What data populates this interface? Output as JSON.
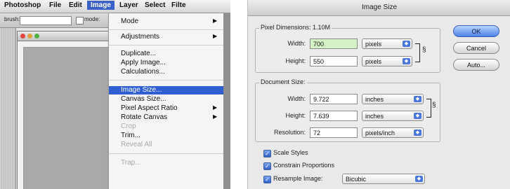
{
  "left": {
    "menubar": [
      "Photoshop",
      "File",
      "Edit",
      "Image",
      "Layer",
      "Select",
      "Filte"
    ],
    "active_menu": "Image",
    "options": {
      "brush_label": "brush:",
      "mode_label": "mode:"
    },
    "image_menu": {
      "items": [
        {
          "label": "Mode",
          "submenu": true,
          "state": "normal"
        },
        {
          "label": "Adjustments",
          "submenu": true,
          "state": "normal"
        },
        {
          "label": "Duplicate...",
          "submenu": false,
          "state": "normal"
        },
        {
          "label": "Apply Image...",
          "submenu": false,
          "state": "normal"
        },
        {
          "label": "Calculations...",
          "submenu": false,
          "state": "normal"
        },
        {
          "label": "Image Size...",
          "submenu": false,
          "state": "selected"
        },
        {
          "label": "Canvas Size...",
          "submenu": false,
          "state": "normal"
        },
        {
          "label": "Pixel Aspect Ratio",
          "submenu": true,
          "state": "normal"
        },
        {
          "label": "Rotate Canvas",
          "submenu": true,
          "state": "normal"
        },
        {
          "label": "Crop",
          "submenu": false,
          "state": "disabled"
        },
        {
          "label": "Trim...",
          "submenu": false,
          "state": "normal"
        },
        {
          "label": "Reveal All",
          "submenu": false,
          "state": "disabled"
        },
        {
          "label": "Trap...",
          "submenu": false,
          "state": "disabled"
        }
      ]
    }
  },
  "dialog": {
    "title": "Image Size",
    "pixel_dimensions": {
      "label": "Pixel Dimensions: 1.10M",
      "width_label": "Width:",
      "width_value": "700",
      "width_unit": "pixels",
      "height_label": "Height:",
      "height_value": "550",
      "height_unit": "pixels"
    },
    "document_size": {
      "label": "Document Size:",
      "width_label": "Width:",
      "width_value": "9.722",
      "width_unit": "inches",
      "height_label": "Height:",
      "height_value": "7.639",
      "height_unit": "inches",
      "resolution_label": "Resolution:",
      "resolution_value": "72",
      "resolution_unit": "pixels/inch"
    },
    "checkboxes": [
      {
        "label": "Scale Styles",
        "checked": true
      },
      {
        "label": "Constrain Proportions",
        "checked": true
      },
      {
        "label": "Resample Image:",
        "checked": true
      }
    ],
    "resample_method": "Bicubic",
    "buttons": {
      "ok": "OK",
      "cancel": "Cancel",
      "auto": "Auto..."
    },
    "accent_color": "#4d82e6"
  }
}
